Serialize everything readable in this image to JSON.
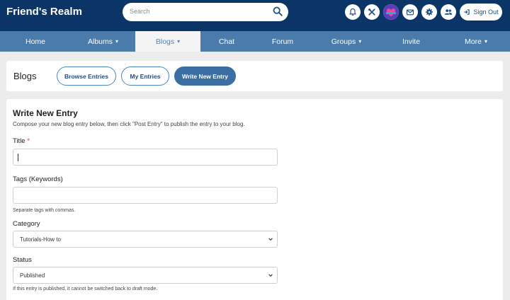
{
  "header": {
    "site_title": "Friend's Realm",
    "search_placeholder": "Search",
    "sign_out_label": "Sign Out",
    "icons": [
      "bell-icon",
      "tools-icon",
      "avatar",
      "mail-icon",
      "gear-icon",
      "users-icon"
    ]
  },
  "nav": {
    "items": [
      {
        "label": "Home",
        "has_menu": false,
        "active": false
      },
      {
        "label": "Albums",
        "has_menu": true,
        "active": false
      },
      {
        "label": "Blogs",
        "has_menu": true,
        "active": true
      },
      {
        "label": "Chat",
        "has_menu": false,
        "active": false
      },
      {
        "label": "Forum",
        "has_menu": false,
        "active": false
      },
      {
        "label": "Groups",
        "has_menu": true,
        "active": false
      },
      {
        "label": "Invite",
        "has_menu": false,
        "active": false
      },
      {
        "label": "More",
        "has_menu": true,
        "active": false
      }
    ]
  },
  "blogs_bar": {
    "title": "Blogs",
    "buttons": [
      {
        "label": "Browse Entries",
        "active": false
      },
      {
        "label": "My Entries",
        "active": false
      },
      {
        "label": "Write New Entry",
        "active": true
      }
    ]
  },
  "form": {
    "title": "Write New Entry",
    "description": "Compose your new blog entry below, then click \"Post Entry\" to publish the entry to your blog.",
    "title_label": "Title",
    "title_required_mark": "*",
    "title_value": "",
    "tags_label": "Tags (Keywords)",
    "tags_value": "",
    "tags_hint": "Separate tags with commas.",
    "category_label": "Category",
    "category_value": "Tutorials-How to",
    "status_label": "Status",
    "status_value": "Published",
    "status_hint": "If this entry is published, it cannot be switched back to draft mode."
  },
  "colors": {
    "header_bg": "#0b3566",
    "nav_bg": "#4a7bab",
    "accent": "#3b6ea3",
    "active_nav_text": "#4a86c5"
  }
}
